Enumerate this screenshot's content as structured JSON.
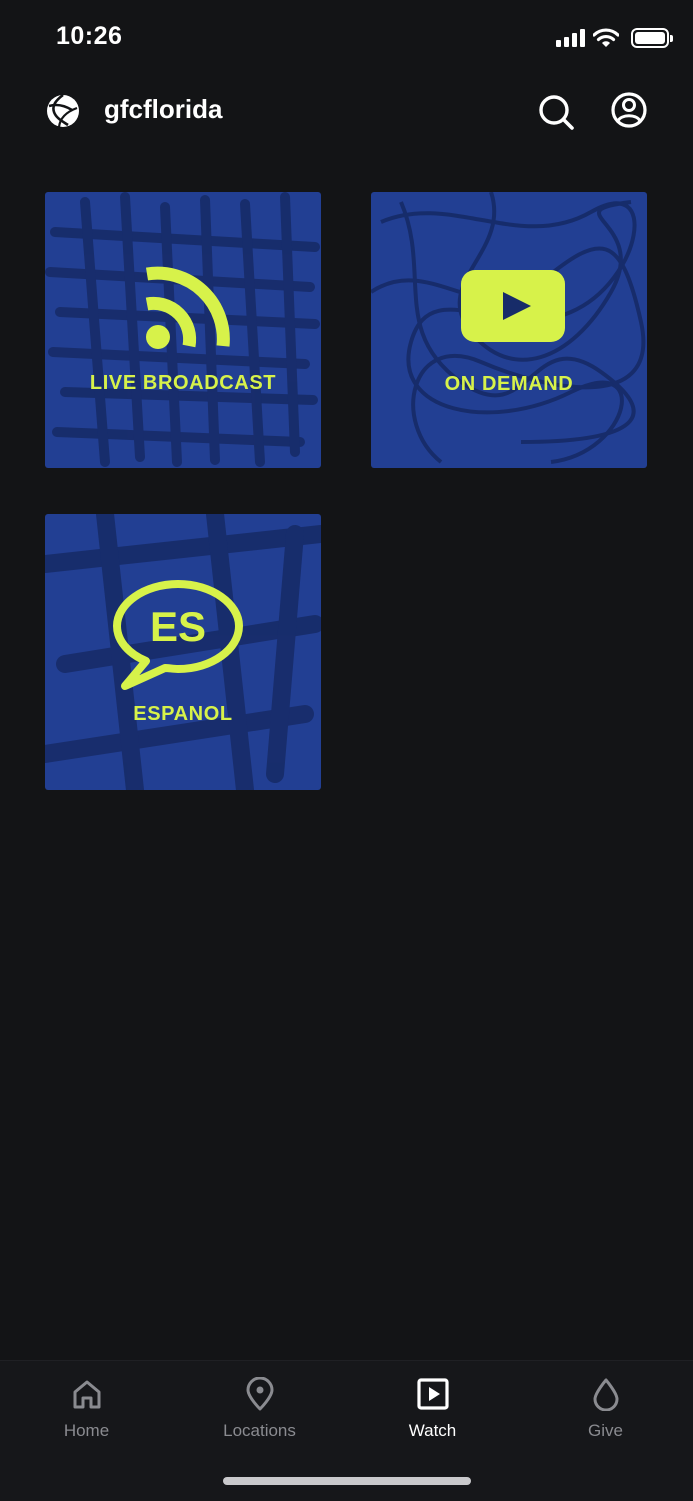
{
  "status_bar": {
    "time": "10:26"
  },
  "header": {
    "title": "gfcflorida"
  },
  "tiles": [
    {
      "label": "LIVE BROADCAST",
      "icon": "rss-icon"
    },
    {
      "label": "ON DEMAND",
      "icon": "play-icon"
    },
    {
      "label": "ESPANOL",
      "icon": "speech-bubble-icon",
      "badge": "ES"
    }
  ],
  "tabs": [
    {
      "label": "Home",
      "icon": "home-icon",
      "active": false
    },
    {
      "label": "Locations",
      "icon": "location-pin-icon",
      "active": false
    },
    {
      "label": "Watch",
      "icon": "play-square-icon",
      "active": true
    },
    {
      "label": "Give",
      "icon": "drop-icon",
      "active": false
    }
  ],
  "colors": {
    "background": "#131416",
    "tile": "#223f93",
    "accent": "#d7f24a",
    "inactive": "#8a8b90"
  }
}
